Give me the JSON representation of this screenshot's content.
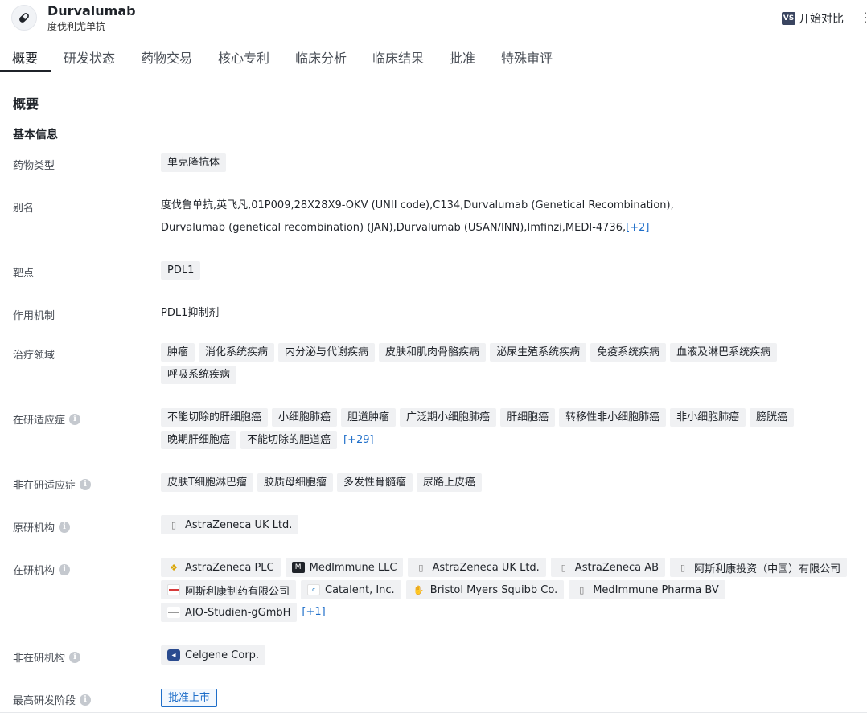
{
  "header": {
    "drug_name": "Durvalumab",
    "drug_name_cn": "度伐利尤单抗",
    "drug_icon": "pill-icon",
    "compare_icon_text": "VS",
    "compare_label": "开始对比"
  },
  "tabs": [
    {
      "label": "概要",
      "active": true
    },
    {
      "label": "研发状态"
    },
    {
      "label": "药物交易"
    },
    {
      "label": "核心专利"
    },
    {
      "label": "临床分析"
    },
    {
      "label": "临床结果"
    },
    {
      "label": "批准"
    },
    {
      "label": "特殊审评"
    }
  ],
  "section_title": "概要",
  "basic_info_title": "基本信息",
  "fields": {
    "drug_type": {
      "label": "药物类型",
      "tags": [
        "单克隆抗体"
      ]
    },
    "alias": {
      "label": "别名",
      "line1": "度伐鲁单抗,英飞凡,01P009,28X28X9-OKV (UNII code),C134,Durvalumab (Genetical Recombination),",
      "line2": "Durvalumab (genetical recombination) (JAN),Durvalumab (USAN/INN),Imfinzi,MEDI-4736,",
      "more": "[+2]"
    },
    "target": {
      "label": "靶点",
      "tags": [
        "PDL1"
      ]
    },
    "mechanism": {
      "label": "作用机制",
      "value": "PDL1抑制剂"
    },
    "therapeutic_area": {
      "label": "治疗领域",
      "tags": [
        "肿瘤",
        "消化系统疾病",
        "内分泌与代谢疾病",
        "皮肤和肌肉骨骼疾病",
        "泌尿生殖系统疾病",
        "免疫系统疾病",
        "血液及淋巴系统疾病",
        "呼吸系统疾病"
      ]
    },
    "active_indications": {
      "label": "在研适应症",
      "tags": [
        "不能切除的肝细胞癌",
        "小细胞肺癌",
        "胆道肿瘤",
        "广泛期小细胞肺癌",
        "肝细胞癌",
        "转移性非小细胞肺癌",
        "非小细胞肺癌",
        "膀胱癌",
        "晚期肝细胞癌",
        "不能切除的胆道癌"
      ],
      "more": "[+29]"
    },
    "inactive_indications": {
      "label": "非在研适应症",
      "tags": [
        "皮肤T细胞淋巴瘤",
        "胶质母细胞瘤",
        "多发性骨髓瘤",
        "尿路上皮癌"
      ]
    },
    "originator": {
      "label": "原研机构",
      "orgs": [
        {
          "name": "AstraZeneca UK Ltd.",
          "logo": "building-icon"
        }
      ]
    },
    "active_orgs": {
      "label": "在研机构",
      "orgs": [
        {
          "name": "AstraZeneca PLC",
          "logo": "astrazeneca-logo"
        },
        {
          "name": "MedImmune LLC",
          "logo": "medimmune-logo"
        },
        {
          "name": "AstraZeneca UK Ltd.",
          "logo": "building-icon"
        },
        {
          "name": "AstraZeneca AB",
          "logo": "building-icon"
        },
        {
          "name": "阿斯利康投资（中国）有限公司",
          "logo": "building-icon"
        },
        {
          "name": "阿斯利康制药有限公司",
          "logo": "company-logo"
        },
        {
          "name": "Catalent, Inc.",
          "logo": "catalent-logo"
        },
        {
          "name": "Bristol Myers Squibb Co.",
          "logo": "bms-logo"
        },
        {
          "name": "MedImmune Pharma BV",
          "logo": "building-icon"
        },
        {
          "name": "AIO-Studien-gGmbH",
          "logo": "aio-logo"
        }
      ],
      "more": "[+1]"
    },
    "inactive_orgs": {
      "label": "非在研机构",
      "orgs": [
        {
          "name": "Celgene Corp.",
          "logo": "celgene-logo"
        }
      ]
    },
    "highest_phase": {
      "label": "最高研发阶段",
      "value": "批准上市"
    }
  }
}
